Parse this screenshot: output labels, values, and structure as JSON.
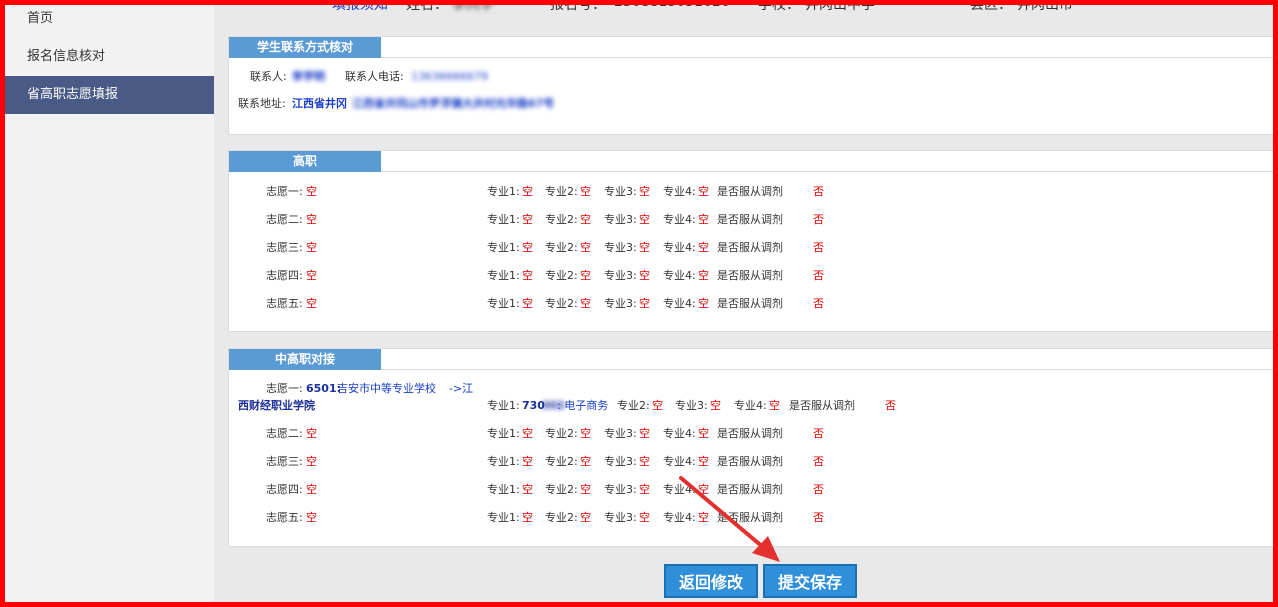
{
  "sidebar": {
    "items": [
      {
        "label": "首页"
      },
      {
        "label": "报名信息核对"
      },
      {
        "label": "省高职志愿填报"
      }
    ]
  },
  "topbar": {
    "link": "填报须知",
    "name_label": "姓名：",
    "name_value": "李同学",
    "reg_label": "报名号：",
    "reg_value": "2308813051026",
    "school_label": "学校：",
    "school_value": "井冈山中学",
    "county_label": "县区：",
    "county_value": "井冈山市"
  },
  "contact": {
    "title": "学生联系方式核对",
    "person_label": "联系人:",
    "person_value": "李学明",
    "phone_label": "联系人电话:",
    "phone_value": "13636666679",
    "address_label": "联系地址:",
    "address_value": "江西省井冈山市罗浮镇大井村光华路67号"
  },
  "gaozhi": {
    "title": "高职",
    "rows": [
      {
        "label": "志愿一:",
        "value": "空"
      },
      {
        "label": "志愿二:",
        "value": "空"
      },
      {
        "label": "志愿三:",
        "value": "空"
      },
      {
        "label": "志愿四:",
        "value": "空"
      },
      {
        "label": "志愿五:",
        "value": "空"
      }
    ]
  },
  "majors": {
    "m1": "专业1:",
    "m2": "专业2:",
    "m3": "专业3:",
    "m4": "专业4:",
    "empty": "空",
    "adjust_label": "是否服从调剂",
    "adjust_value": "否"
  },
  "zhonggao": {
    "title": "中高职对接",
    "first_label": "志愿一:",
    "first_value_a": "6501:",
    "first_value_b": "吉安市中等专业学校",
    "first_value_c": "->江",
    "first_value_d": "西财经职业学院",
    "first_major_code": "730",
    "first_major_code_blur": "302",
    "first_major_name": ": 电子商务",
    "rows": [
      {
        "label": "志愿二:",
        "value": "空"
      },
      {
        "label": "志愿三:",
        "value": "空"
      },
      {
        "label": "志愿四:",
        "value": "空"
      },
      {
        "label": "志愿五:",
        "value": "空"
      }
    ]
  },
  "buttons": {
    "back": "返回修改",
    "submit": "提交保存"
  },
  "colors": {
    "frame": "#ff0000",
    "sidebar_active": "#4a5a86",
    "panel_title": "#5b9bd5",
    "button": "#2f8fd8",
    "arrow": "#e53030"
  }
}
